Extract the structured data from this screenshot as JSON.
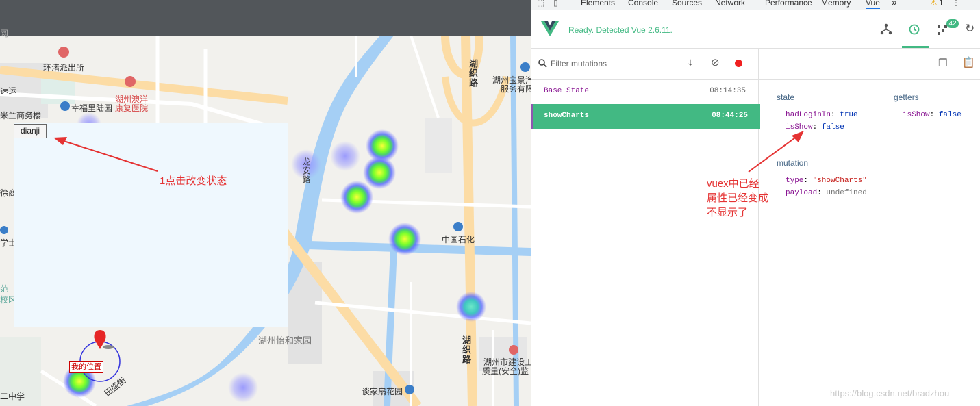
{
  "map": {
    "pois": {
      "police": "环渚派出所",
      "kuaiyun": "速运",
      "milan": "米兰商务楼",
      "xingfu": "幸福里陆园",
      "hospital_line1": "湖州澳洋",
      "hospital_line2": "康复医院",
      "longan": "龙安路",
      "huzhi_top": "湖织路",
      "huzhi_bottom": "湖织路",
      "baojing_line1": "湖州宝景汽",
      "baojing_line2": "服务有限",
      "sinopec": "中国石化",
      "yihe": "湖州怡和家园",
      "jianshe_line1": "湖州市建设工",
      "jianshe_line2": "质量(安全)监",
      "tanjia": "谈家扇花园",
      "tiansheng": "田盛街",
      "edge_school": "二中学",
      "edge_fan": "范",
      "edge_xiaoqu": "校区",
      "edge_xue": "学士",
      "edge_shang": "徐商务",
      "edge_top": "网"
    },
    "button_label": "dianji",
    "annotation": "1点击改变状态",
    "my_location": "我的位置"
  },
  "devtools": {
    "tabs": [
      "Elements",
      "Console",
      "Sources",
      "Network",
      "Performance",
      "Memory",
      "Vue"
    ],
    "more_tabs": "»",
    "warning_count": "1",
    "ready_text": "Ready. Detected Vue 2.6.11.",
    "badge_count": "42",
    "filter_placeholder": "Filter mutations",
    "mutations": [
      {
        "name": "Base State",
        "time": "08:14:35"
      },
      {
        "name": "showCharts",
        "time": "08:44:25"
      }
    ],
    "state_title": "state",
    "getters_title": "getters",
    "state": [
      {
        "key": "hadLoginIn",
        "value": "true"
      },
      {
        "key": "isShow",
        "value": "false"
      }
    ],
    "getters": [
      {
        "key": "isShow",
        "value": "false"
      }
    ],
    "mutation_title": "mutation",
    "mutation": [
      {
        "key": "type",
        "value": "\"showCharts\""
      },
      {
        "key": "payload",
        "value": "undefined"
      }
    ],
    "annotation_lines": [
      "vuex中已经",
      "属性已经变成",
      "不显示了"
    ],
    "colors": {
      "vue_green": "#42b983",
      "annotation_red": "#e53333",
      "key_purple": "#881391"
    }
  },
  "watermark": "https://blog.csdn.net/bradzhou"
}
